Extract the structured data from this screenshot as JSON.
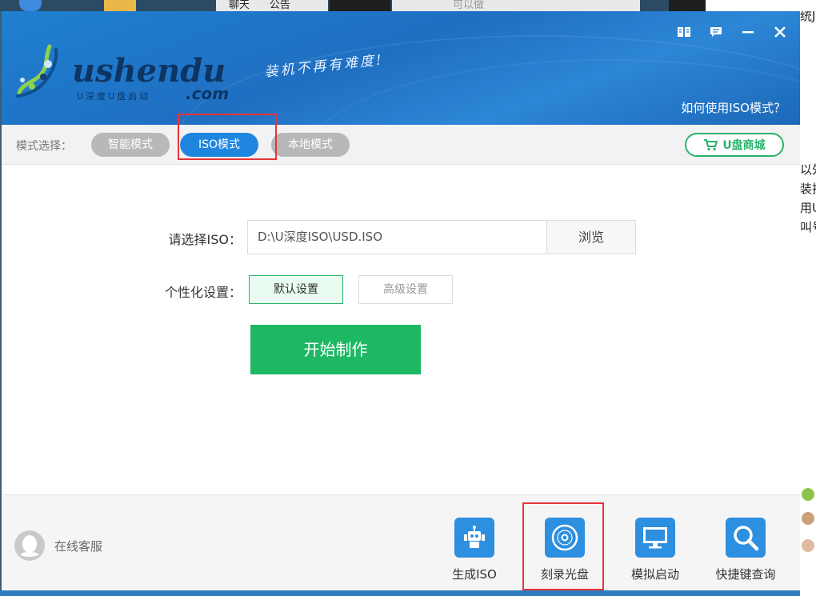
{
  "background": {
    "top_tabs": [
      "聊天",
      "公告",
      "可以做"
    ],
    "right_text": [
      "统J",
      "以外",
      "装挂",
      "用U",
      "叫号"
    ]
  },
  "app": {
    "logo": {
      "brand": "ushendu",
      "tagline": "U深度U盘启动",
      "suffix": ".com"
    },
    "slogan": "装机不再有难度!",
    "help_link": "如何使用ISO模式？",
    "window_controls": [
      "book-icon",
      "message-icon",
      "minimize-icon",
      "close-icon"
    ],
    "mode_select": {
      "label": "模式选择：",
      "modes": [
        {
          "label": "智能模式",
          "active": false
        },
        {
          "label": "ISO模式",
          "active": true
        },
        {
          "label": "本地模式",
          "active": false
        }
      ]
    },
    "mall_button": "U盘商城",
    "form": {
      "iso_label": "请选择ISO：",
      "iso_path": "D:\\U深度ISO\\USD.ISO",
      "browse_label": "浏览",
      "personal_label": "个性化设置：",
      "default_settings": "默认设置",
      "advanced_settings": "高级设置",
      "start_button": "开始制作"
    },
    "footer": {
      "support_label": "在线客服",
      "tools": [
        {
          "label": "生成ISO",
          "icon": "robot-icon"
        },
        {
          "label": "刻录光盘",
          "icon": "disc-icon"
        },
        {
          "label": "模拟启动",
          "icon": "monitor-icon"
        },
        {
          "label": "快捷键查询",
          "icon": "magnifier-icon"
        }
      ]
    }
  },
  "colors": {
    "header_blue": "#1f6fc2",
    "active_pill": "#1f86e0",
    "start_green": "#1eb865",
    "highlight_red": "#e8333a"
  }
}
